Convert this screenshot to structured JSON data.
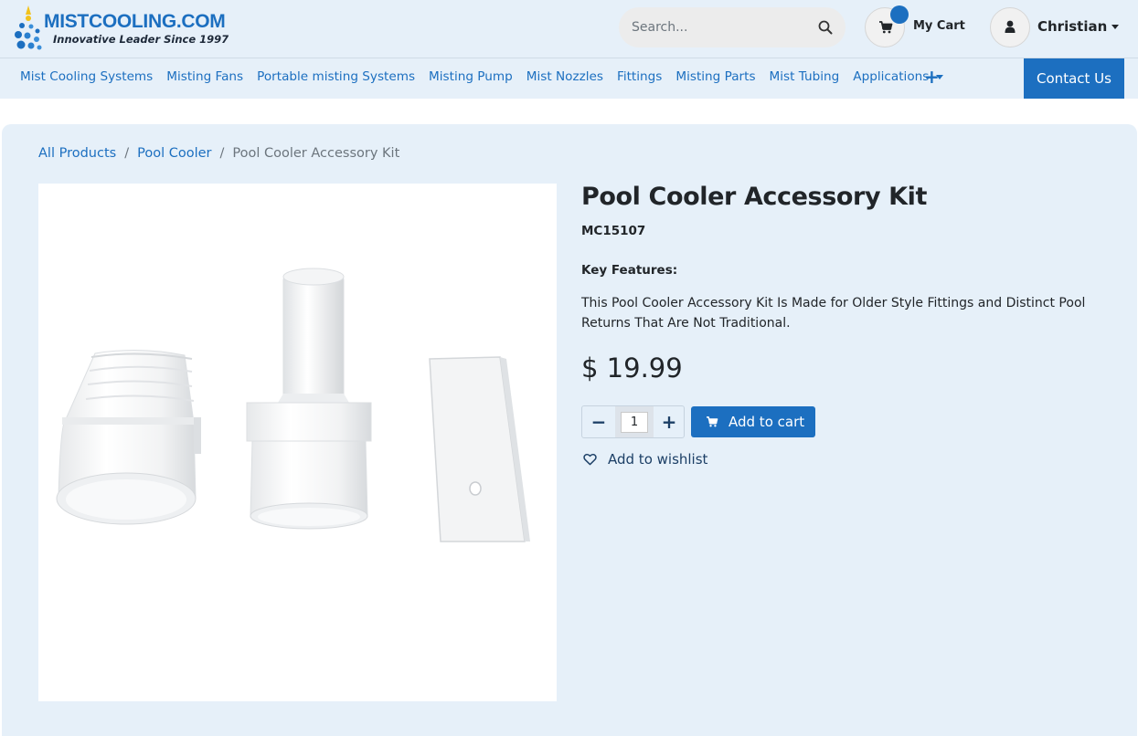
{
  "brand": {
    "name": "MISTCOOLING.COM",
    "tagline": "Innovative Leader Since 1997"
  },
  "search": {
    "placeholder": "Search..."
  },
  "cart": {
    "label": "My Cart"
  },
  "user": {
    "name": "Christian"
  },
  "nav": {
    "items": [
      "Mist Cooling Systems",
      "Misting Fans",
      "Portable misting Systems",
      "Misting Pump",
      "Mist Nozzles",
      "Fittings",
      "Misting Parts",
      "Mist Tubing",
      "Applications"
    ],
    "more": "+",
    "contact": "Contact Us"
  },
  "breadcrumb": {
    "items": [
      "All Products",
      "Pool Cooler"
    ],
    "current": "Pool Cooler Accessory Kit",
    "separator": "/"
  },
  "product": {
    "title": "Pool Cooler Accessory Kit",
    "sku": "MC15107",
    "key_features_label": "Key Features:",
    "description": "This Pool Cooler Accessory Kit Is Made for Older Style Fittings and Distinct Pool Returns That Are Not Traditional.",
    "price": "$ 19.99",
    "quantity": "1",
    "minus": "−",
    "plus": "+",
    "add_to_cart": "Add to cart",
    "wishlist": "Add to wishlist"
  },
  "colors": {
    "accent": "#1c6fc0",
    "header_bg": "#e6f0f9"
  },
  "icons": [
    "search-icon",
    "cart-icon",
    "user-icon",
    "heart-icon",
    "caret-down-icon"
  ]
}
